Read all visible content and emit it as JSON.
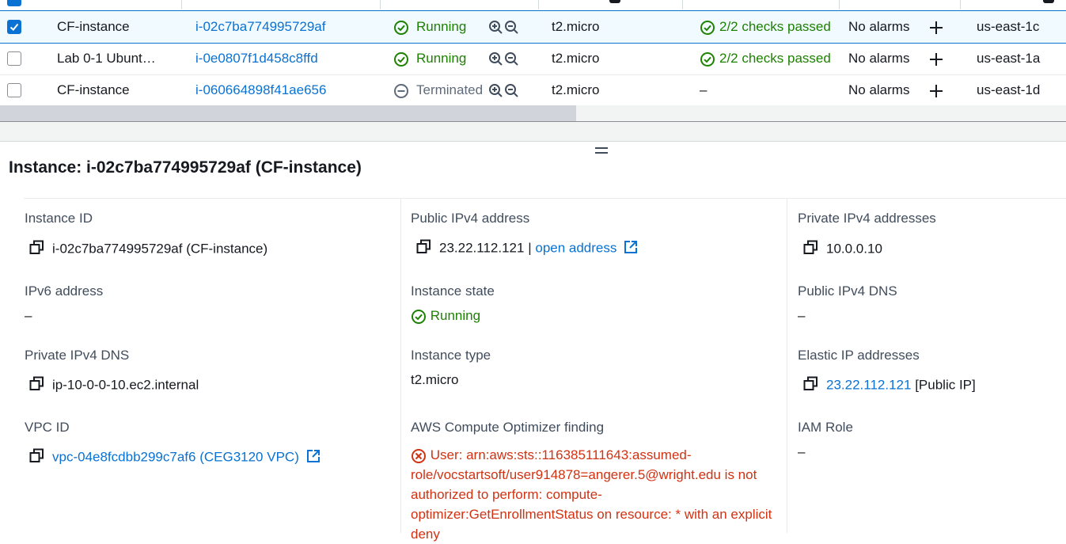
{
  "table": {
    "rows": [
      {
        "selected": true,
        "name": "CF-instance",
        "instance_id": "i-02c7ba774995729af",
        "state": "Running",
        "state_icon": "check-circle-icon",
        "type": "t2.micro",
        "status_check": "2/2 checks passed",
        "alarms": "No alarms",
        "az": "us-east-1c"
      },
      {
        "selected": false,
        "name": "Lab 0-1 Ubunt…",
        "instance_id": "i-0e0807f1d458c8ffd",
        "state": "Running",
        "state_icon": "check-circle-icon",
        "type": "t2.micro",
        "status_check": "2/2 checks passed",
        "alarms": "No alarms",
        "az": "us-east-1a"
      },
      {
        "selected": false,
        "name": "CF-instance",
        "instance_id": "i-060664898f41ae656",
        "state": "Terminated",
        "state_icon": "minus-circle-icon",
        "type": "t2.micro",
        "status_check": "–",
        "alarms": "No alarms",
        "az": "us-east-1d"
      }
    ]
  },
  "details": {
    "title": "Instance: i-02c7ba774995729af (CF-instance)",
    "col1": {
      "instance_id_label": "Instance ID",
      "instance_id_value": "i-02c7ba774995729af (CF-instance)",
      "ipv6_label": "IPv6 address",
      "ipv6_value": "–",
      "private_dns_label": "Private IPv4 DNS",
      "private_dns_value": "ip-10-0-0-10.ec2.internal",
      "vpc_label": "VPC ID",
      "vpc_value": "vpc-04e8fcdbb299c7af6 (CEG3120 VPC)"
    },
    "col2": {
      "public_ip_label": "Public IPv4 address",
      "public_ip_value": "23.22.112.121",
      "public_ip_sep": "|",
      "open_address": "open address",
      "state_label": "Instance state",
      "state_value": "Running",
      "type_label": "Instance type",
      "type_value": "t2.micro",
      "optimizer_label": "AWS Compute Optimizer finding",
      "optimizer_error": "User: arn:aws:sts::116385111643:assumed-role/vocstartsoft/user914878=angerer.5@wright.edu is not authorized to perform: compute-optimizer:GetEnrollmentStatus on resource: * with an explicit deny"
    },
    "col3": {
      "private_ip_label": "Private IPv4 addresses",
      "private_ip_value": "10.0.0.10",
      "public_dns_label": "Public IPv4 DNS",
      "public_dns_value": "–",
      "elastic_ip_label": "Elastic IP addresses",
      "elastic_ip_value": "23.22.112.121",
      "elastic_ip_suffix": "[Public IP]",
      "iam_label": "IAM Role",
      "iam_value": "–"
    }
  },
  "colors": {
    "link": "#0972d3",
    "success": "#1d8102",
    "error": "#d13212",
    "selected_row_bg": "#f1faff"
  }
}
